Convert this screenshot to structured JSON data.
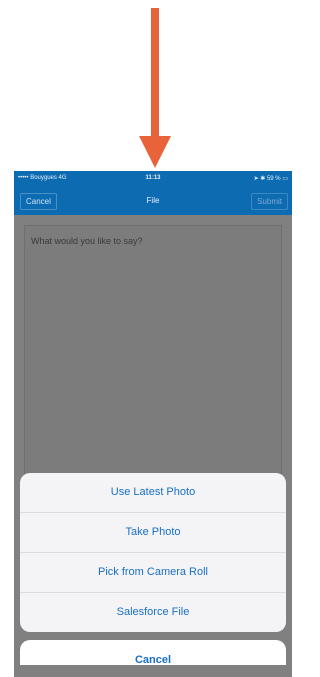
{
  "colors": {
    "arrow": "#e8623a",
    "nav_background": "#0d6bb2",
    "overlay": "#808080",
    "action_text": "#1a6fc4"
  },
  "status_bar": {
    "carrier": "Bouygues",
    "network": "4G",
    "time": "11:13",
    "battery": "59 %"
  },
  "nav": {
    "cancel_label": "Cancel",
    "title": "File",
    "submit_label": "Submit"
  },
  "composer": {
    "placeholder": "What would you like to say?"
  },
  "action_sheet": {
    "items": [
      {
        "label": "Use Latest Photo"
      },
      {
        "label": "Take Photo"
      },
      {
        "label": "Pick from Camera Roll"
      },
      {
        "label": "Salesforce File"
      }
    ],
    "cancel_label": "Cancel"
  }
}
